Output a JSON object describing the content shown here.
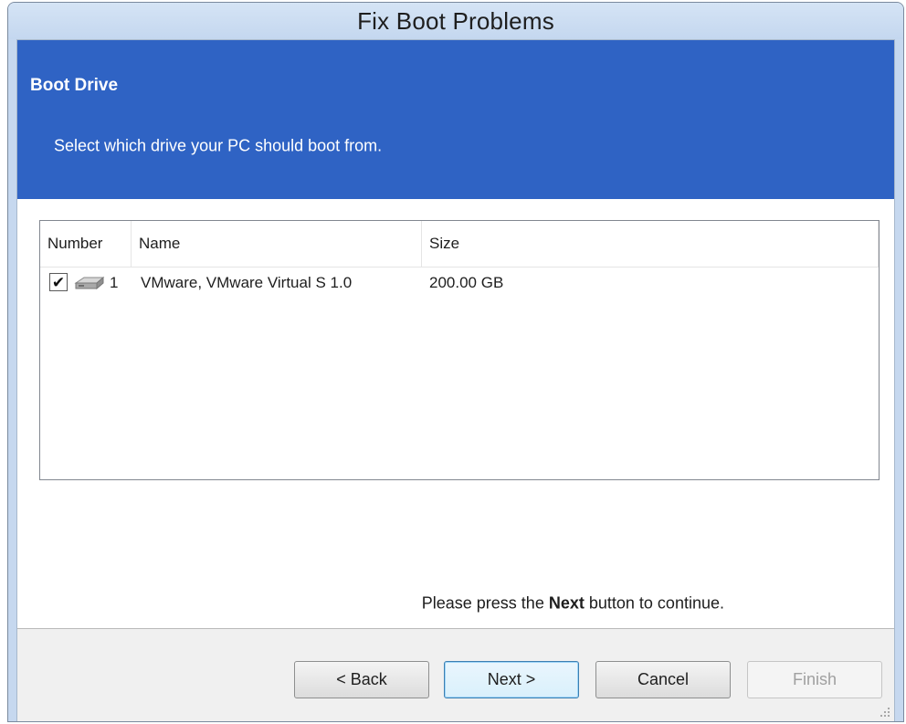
{
  "window": {
    "title": "Fix Boot Problems"
  },
  "header": {
    "title": "Boot Drive",
    "subtitle": "Select which drive your PC should boot from."
  },
  "drive_list": {
    "columns": [
      "Number",
      "Name",
      "Size"
    ],
    "rows": [
      {
        "checked": true,
        "check_glyph": "✔",
        "icon": "hard-drive-icon",
        "number": "1",
        "name": "VMware,  VMware Virtual S 1.0",
        "size": "200.00 GB"
      }
    ]
  },
  "hint": {
    "prefix": "Please press the",
    "emphasis": "Next",
    "suffix": "button to continue."
  },
  "buttons": {
    "back": "< Back",
    "next": "Next >",
    "cancel": "Cancel",
    "finish": "Finish"
  },
  "colors": {
    "header_bg": "#2f63c4",
    "titlebar_bg": "#c6d8ef",
    "footer_bg": "#f0f0f0"
  }
}
